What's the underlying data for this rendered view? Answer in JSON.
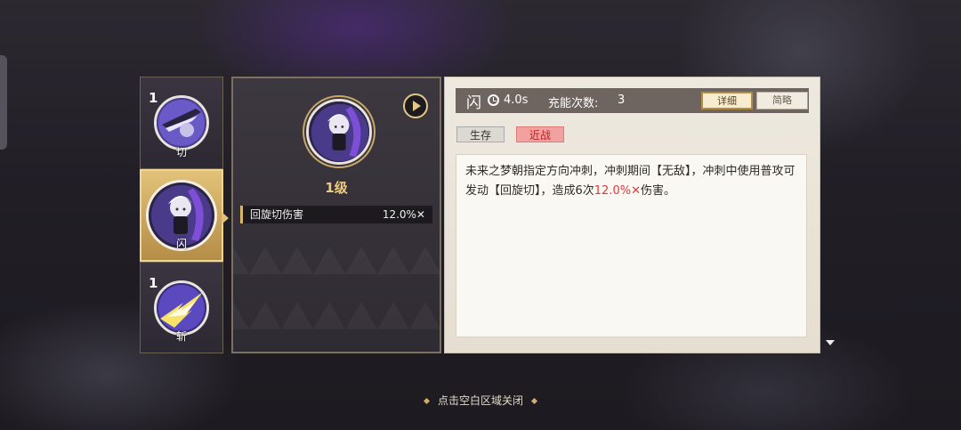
{
  "skills": [
    {
      "level": "1",
      "label": "切"
    },
    {
      "level": "",
      "label": "闪"
    },
    {
      "level": "1",
      "label": "斩"
    }
  ],
  "detail_panel": {
    "level_text": "1级",
    "stat_name": "回旋切伤害",
    "stat_value": "12.0%✕"
  },
  "info": {
    "skill_name": "闪",
    "cooldown": "4.0s",
    "charge_label": "充能次数:",
    "charge_value": "3",
    "btn_detail": "详细",
    "btn_brief": "简略",
    "tags": [
      "生存",
      "近战"
    ],
    "desc_part1": "未来之梦朝指定方向冲刺，冲刺期间【无敌】，冲刺中使用普攻可发动【回旋切】，造成6次",
    "desc_highlight": "12.0%✕",
    "desc_part2": "伤害。"
  },
  "footer": {
    "hint": "点击空白区域关闭"
  },
  "colors": {
    "accent_gold": "#e2c27a",
    "highlight_red": "#e0393e",
    "header_bg": "#6e6460"
  }
}
